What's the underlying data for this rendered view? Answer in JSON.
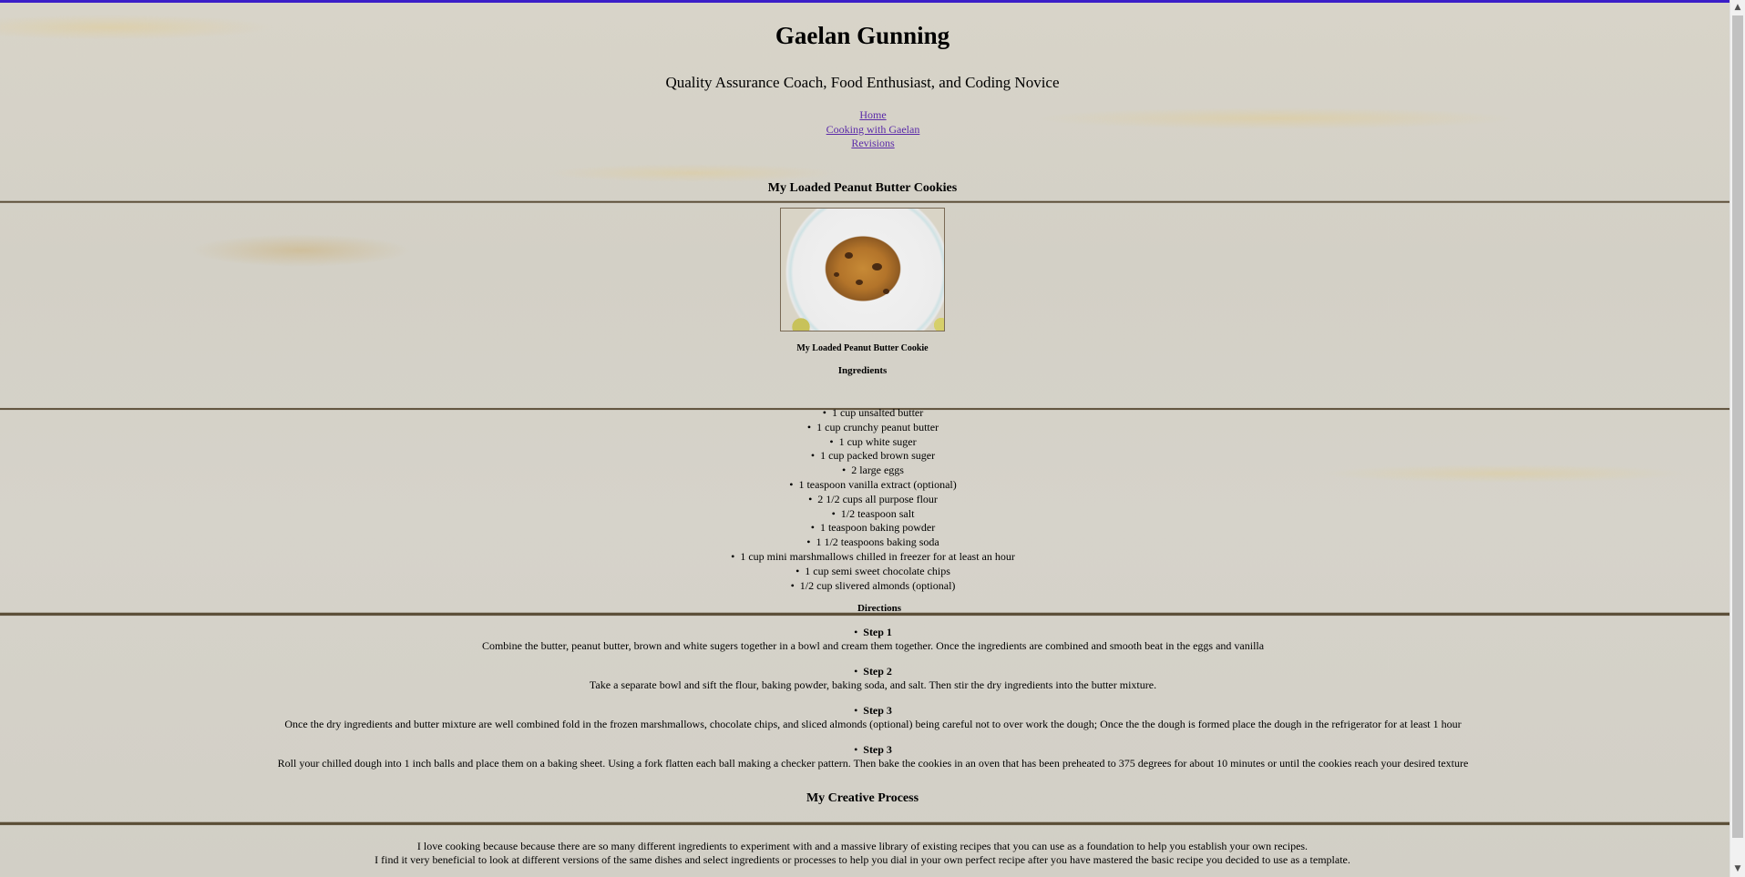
{
  "header": {
    "title": "Gaelan Gunning",
    "subtitle": "Quality Assurance Coach, Food Enthusiast, and Coding Novice"
  },
  "nav": {
    "items": [
      {
        "label": "Home"
      },
      {
        "label": "Cooking with Gaelan"
      },
      {
        "label": "Revisions"
      }
    ]
  },
  "recipe": {
    "title": "My Loaded Peanut Butter Cookies",
    "image_caption": "My Loaded Peanut Butter Cookie",
    "ingredients_heading": "Ingredients",
    "ingredients": [
      "1 cup unsalted butter",
      "1 cup crunchy peanut butter",
      "1 cup white suger",
      "1 cup packed brown suger",
      "2 large eggs",
      "1 teaspoon vanilla extract (optional)",
      "2 1/2 cups all purpose flour",
      "1/2 teaspoon salt",
      "1 teaspoon baking powder",
      "1 1/2 teaspoons baking soda",
      "1 cup mini marshmallows chilled in freezer for at least an hour",
      "1 cup semi sweet chocolate chips",
      "1/2 cup slivered almonds (optional)"
    ],
    "directions_heading": "Directions",
    "steps": [
      {
        "title": "Step 1",
        "text": "Combine the butter, peanut butter, brown and white sugers together in a bowl and cream them together. Once the ingredients are combined and smooth beat in the eggs and vanilla"
      },
      {
        "title": "Step 2",
        "text": "Take a separate bowl and sift the flour, baking powder, baking soda, and salt. Then stir the dry ingredients into the butter mixture."
      },
      {
        "title": "Step 3",
        "text": "Once the dry ingredients and butter mixture are well combined fold in the frozen marshmallows, chocolate chips, and sliced almonds (optional) being careful not to over work the dough; Once the the dough is formed place the dough in the refrigerator for at least 1 hour"
      },
      {
        "title": "Step 3",
        "text": "Roll your chilled dough into 1 inch balls and place them on a baking sheet. Using a fork flatten each ball making a checker pattern. Then bake the cookies in an oven that has been preheated to 375 degrees for about 10 minutes or until the cookies reach your desired texture"
      }
    ]
  },
  "creative": {
    "heading": "My Creative Process",
    "lines": [
      "I love cooking because because there are so many different ingredients to experiment with and a massive library of existing recipes that you can use as a foundation to help you establish your own recipes.",
      "I find it very beneficial to look at different versions of the same dishes and select ingredients or processes to help you dial in your own perfect recipe after you have mastered the basic recipe you decided to use as a template."
    ]
  },
  "scrollbar": {
    "up_icon": "▲",
    "down_icon": "▼"
  },
  "colors": {
    "accent_bar": "#3b1ec8",
    "link": "#5a2aa8"
  }
}
